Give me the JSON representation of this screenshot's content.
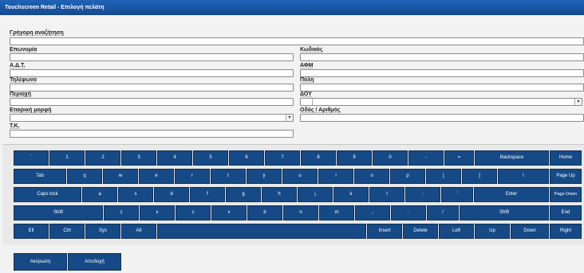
{
  "window": {
    "title": "Touchscreen Retail - Επιλογή πελάτη"
  },
  "form": {
    "quick_search_label": "Γρήγορη αναζήτηση",
    "surname_label": "Επωνυμία",
    "code_label": "Κωδικός",
    "id_label": "Α.Δ.Τ.",
    "afm_label": "ΑΦΜ",
    "phone_label": "Τηλέφωνο",
    "city_label": "Πόλη",
    "area_label": "Περιοχή",
    "doy_label": "ΔΟΥ",
    "company_form_label": "Εταιρική μορφή",
    "street_label": "Οδός / Αριθμός",
    "postal_label": "Τ.Κ."
  },
  "keyboard": {
    "row1": [
      "`",
      "1",
      "2",
      "3",
      "4",
      "5",
      "6",
      "7",
      "8",
      "9",
      "0",
      "-",
      "=",
      "Backspace",
      "Home"
    ],
    "row2": [
      "Tab",
      "q",
      "w",
      "e",
      "r",
      "t",
      "y",
      "u",
      "i",
      "o",
      "p",
      "[",
      "]",
      "\\",
      "Page Up"
    ],
    "row3": [
      "Caps lock",
      "a",
      "s",
      "d",
      "f",
      "g",
      "h",
      "j",
      "k",
      "l",
      ";",
      "'",
      "Enter",
      "Page Down"
    ],
    "row4": [
      "Shift",
      "z",
      "x",
      "c",
      "v",
      "b",
      "n",
      "m",
      ",",
      ".",
      "/",
      "Shift",
      "End"
    ],
    "row5": [
      "Εll",
      "Ctrl",
      "Sys",
      "Alt",
      "",
      "Insert",
      "Delete",
      "Left",
      "Up",
      "Down",
      "Right"
    ]
  },
  "actions": {
    "cancel": "Ακύρωση",
    "accept": "Αποδοχή"
  }
}
